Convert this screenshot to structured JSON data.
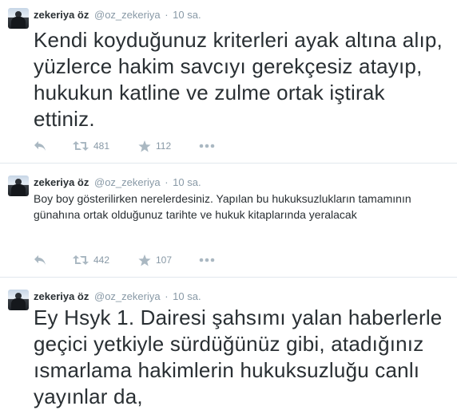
{
  "tweets": [
    {
      "name": "zekeriya öz",
      "handle": "@oz_zekeriya",
      "separator": "·",
      "time": "10 sa.",
      "text": "Kendi koyduğunuz kriterleri ayak altına alıp, yüzlerce hakim savcıyı gerekçesiz atayıp, hukukun katline ve zulme ortak iştirak ettiniz.",
      "retweets": "481",
      "favorites": "112"
    },
    {
      "name": "zekeriya öz",
      "handle": "@oz_zekeriya",
      "separator": "·",
      "time": "10 sa.",
      "text": "Boy boy gösterilirken nerelerdesiniz. Yapılan bu hukuksuzlukların tamamının günahına ortak olduğunuz tarihte ve hukuk kitaplarında yeralacak",
      "retweets": "442",
      "favorites": "107"
    },
    {
      "name": "zekeriya öz",
      "handle": "@oz_zekeriya",
      "separator": "·",
      "time": "10 sa.",
      "text": "Ey Hsyk 1. Dairesi şahsımı yalan haberlerle geçici yetkiyle sürdüğünüz gibi, atadığınız ısmarlama hakimlerin hukuksuzluğu canlı yayınlar da,"
    }
  ],
  "icons": {
    "reply": "reply-icon",
    "retweet": "retweet-icon",
    "favorite": "star-icon",
    "more": "more-icon"
  },
  "colors": {
    "text": "#292f33",
    "muted": "#8899a6",
    "icon": "#aab8c2",
    "divider": "#e1e8ed"
  }
}
